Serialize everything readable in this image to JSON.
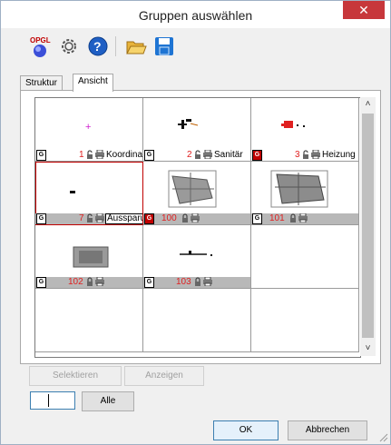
{
  "window": {
    "title": "Gruppen auswählen",
    "close_glyph": "✕"
  },
  "toolbar": {
    "items": [
      {
        "icon": "opgl-icon",
        "text": "OPGL"
      },
      {
        "icon": "gear-icon"
      },
      {
        "icon": "help-icon",
        "text": "?"
      },
      {
        "icon": "folder-open-icon"
      },
      {
        "icon": "save-icon"
      }
    ]
  },
  "tabs": [
    {
      "label": "Struktur",
      "active": false
    },
    {
      "label": "Ansicht",
      "active": true
    }
  ],
  "groups": [
    {
      "badge": "G",
      "badge_color": "white",
      "number": "1",
      "label": "Koordinaten",
      "boxed": false,
      "grey": false,
      "selected": false
    },
    {
      "badge": "G",
      "badge_color": "white",
      "number": "2",
      "label": "Sanitär",
      "boxed": false,
      "grey": false,
      "selected": false
    },
    {
      "badge": "G",
      "badge_color": "red",
      "number": "3",
      "label": "Heizung",
      "boxed": false,
      "grey": false,
      "selected": false
    },
    {
      "badge": "G",
      "badge_color": "white",
      "number": "7",
      "label": "Aussparung",
      "boxed": true,
      "grey": true,
      "selected": true
    },
    {
      "badge": "G",
      "badge_color": "red",
      "number": "100",
      "label": "",
      "boxed": false,
      "grey": false,
      "selected": false
    },
    {
      "badge": "G",
      "badge_color": "white",
      "number": "101",
      "label": "",
      "boxed": false,
      "grey": true,
      "selected": false
    },
    {
      "badge": "G",
      "badge_color": "white",
      "number": "102",
      "label": "",
      "boxed": false,
      "grey": true,
      "selected": false
    },
    {
      "badge": "G",
      "badge_color": "white",
      "number": "103",
      "label": "",
      "boxed": false,
      "grey": true,
      "selected": false
    }
  ],
  "scrollbar": {
    "up": "˄",
    "down": "˅"
  },
  "buttons": {
    "select": "Selektieren",
    "show": "Anzeigen",
    "all": "Alle",
    "ok": "OK",
    "cancel": "Abbrechen"
  },
  "input": {
    "value": ""
  },
  "colors": {
    "accent_red": "#c00000",
    "number_red": "#e02020",
    "default_button": "#3c7fb1"
  }
}
